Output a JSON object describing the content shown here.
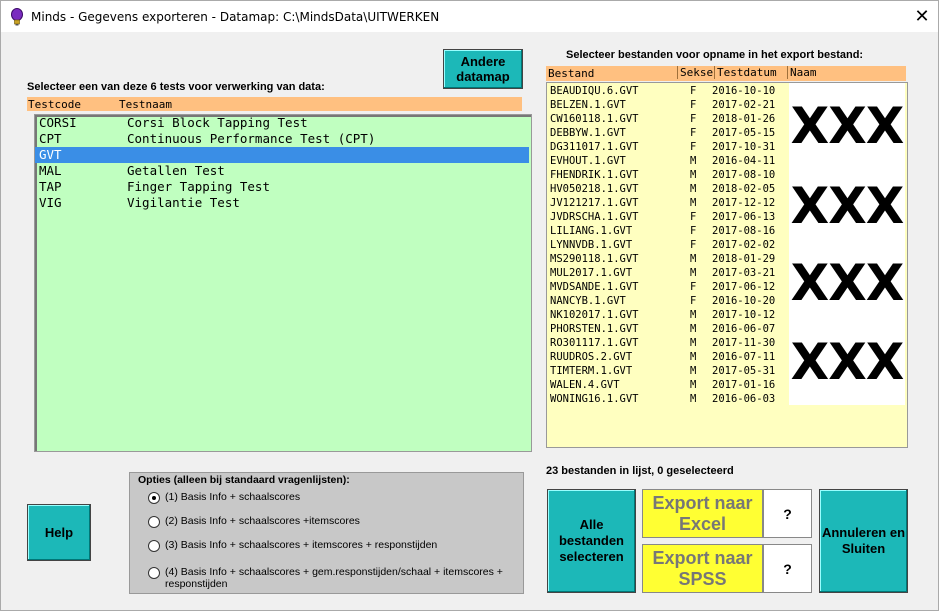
{
  "window": {
    "title": "Minds - Gegevens exporteren - Datamap: C:\\MindsData\\UITWERKEN",
    "close_glyph": "✕"
  },
  "buttons": {
    "andere_datamap": "Andere datamap",
    "help": "Help",
    "alle_selecteren": "Alle bestanden selecteren",
    "export_excel": "Export naar Excel",
    "export_spss": "Export naar SPSS",
    "help_excel": "?",
    "help_spss": "?",
    "annuleren": "Annuleren en Sluiten"
  },
  "test_section": {
    "label": "Selecteer een van deze 6 tests voor verwerking van data:",
    "headers": {
      "code": "Testcode",
      "name": "Testnaam"
    },
    "tests": [
      {
        "code": "CORSI",
        "name": "Corsi Block Tapping Test"
      },
      {
        "code": "CPT",
        "name": "Continuous Performance Test (CPT)"
      },
      {
        "code": "GVT",
        "name": ""
      },
      {
        "code": "MAL",
        "name": "Getallen Test"
      },
      {
        "code": "TAP",
        "name": "Finger Tapping Test"
      },
      {
        "code": "VIG",
        "name": "Vigilantie Test"
      }
    ],
    "selected_code": "GVT"
  },
  "file_section": {
    "label": "Selecteer bestanden voor opname in het export bestand:",
    "headers": {
      "file": "Bestand",
      "sex": "Sekse",
      "date": "Testdatum",
      "name": "Naam"
    },
    "files": [
      {
        "file": "BEAUDIQU.6.GVT",
        "sex": "F",
        "date": "2016-10-10"
      },
      {
        "file": "BELZEN.1.GVT",
        "sex": "F",
        "date": "2017-02-21"
      },
      {
        "file": "CW160118.1.GVT",
        "sex": "F",
        "date": "2018-01-26"
      },
      {
        "file": "DEBBYW.1.GVT",
        "sex": "F",
        "date": "2017-05-15"
      },
      {
        "file": "DG311017.1.GVT",
        "sex": "F",
        "date": "2017-10-31"
      },
      {
        "file": "EVHOUT.1.GVT",
        "sex": "M",
        "date": "2016-04-11"
      },
      {
        "file": "FHENDRIK.1.GVT",
        "sex": "M",
        "date": "2017-08-10"
      },
      {
        "file": "HV050218.1.GVT",
        "sex": "M",
        "date": "2018-02-05"
      },
      {
        "file": "JV121217.1.GVT",
        "sex": "M",
        "date": "2017-12-12"
      },
      {
        "file": "JVDRSCHA.1.GVT",
        "sex": "F",
        "date": "2017-06-13"
      },
      {
        "file": "LILIANG.1.GVT",
        "sex": "F",
        "date": "2017-08-16"
      },
      {
        "file": "LYNNVDB.1.GVT",
        "sex": "F",
        "date": "2017-02-02"
      },
      {
        "file": "MS290118.1.GVT",
        "sex": "M",
        "date": "2018-01-29"
      },
      {
        "file": "MUL2017.1.GVT",
        "sex": "M",
        "date": "2017-03-21"
      },
      {
        "file": "MVDSANDE.1.GVT",
        "sex": "F",
        "date": "2017-06-12"
      },
      {
        "file": "NANCYB.1.GVT",
        "sex": "F",
        "date": "2016-10-20"
      },
      {
        "file": "NK102017.1.GVT",
        "sex": "M",
        "date": "2017-10-12"
      },
      {
        "file": "PHORSTEN.1.GVT",
        "sex": "M",
        "date": "2016-06-07"
      },
      {
        "file": "RO301117.1.GVT",
        "sex": "M",
        "date": "2017-11-30"
      },
      {
        "file": "RUUDROS.2.GVT",
        "sex": "M",
        "date": "2016-07-11"
      },
      {
        "file": "TIMTERM.1.GVT",
        "sex": "M",
        "date": "2017-05-31"
      },
      {
        "file": "WALEN.4.GVT",
        "sex": "M",
        "date": "2017-01-16"
      },
      {
        "file": "WONING16.1.GVT",
        "sex": "M",
        "date": "2016-06-03"
      }
    ],
    "redaction_labels": [
      "XXX",
      "XXX",
      "XXX",
      "XXX"
    ],
    "status": "23 bestanden in lijst, 0 geselecteerd"
  },
  "options": {
    "title": "Opties (alleen bij standaard vragenlijsten):",
    "items": [
      {
        "label": "(1) Basis Info + schaalscores",
        "checked": true
      },
      {
        "label": "(2) Basis Info + schaalscores +itemscores",
        "checked": false
      },
      {
        "label": "(3) Basis Info + schaalscores + itemscores + responstijden",
        "checked": false
      },
      {
        "label": "(4) Basis Info + schaalscores + gem.responstijden/schaal + itemscores + responstijden",
        "checked": false
      }
    ]
  }
}
